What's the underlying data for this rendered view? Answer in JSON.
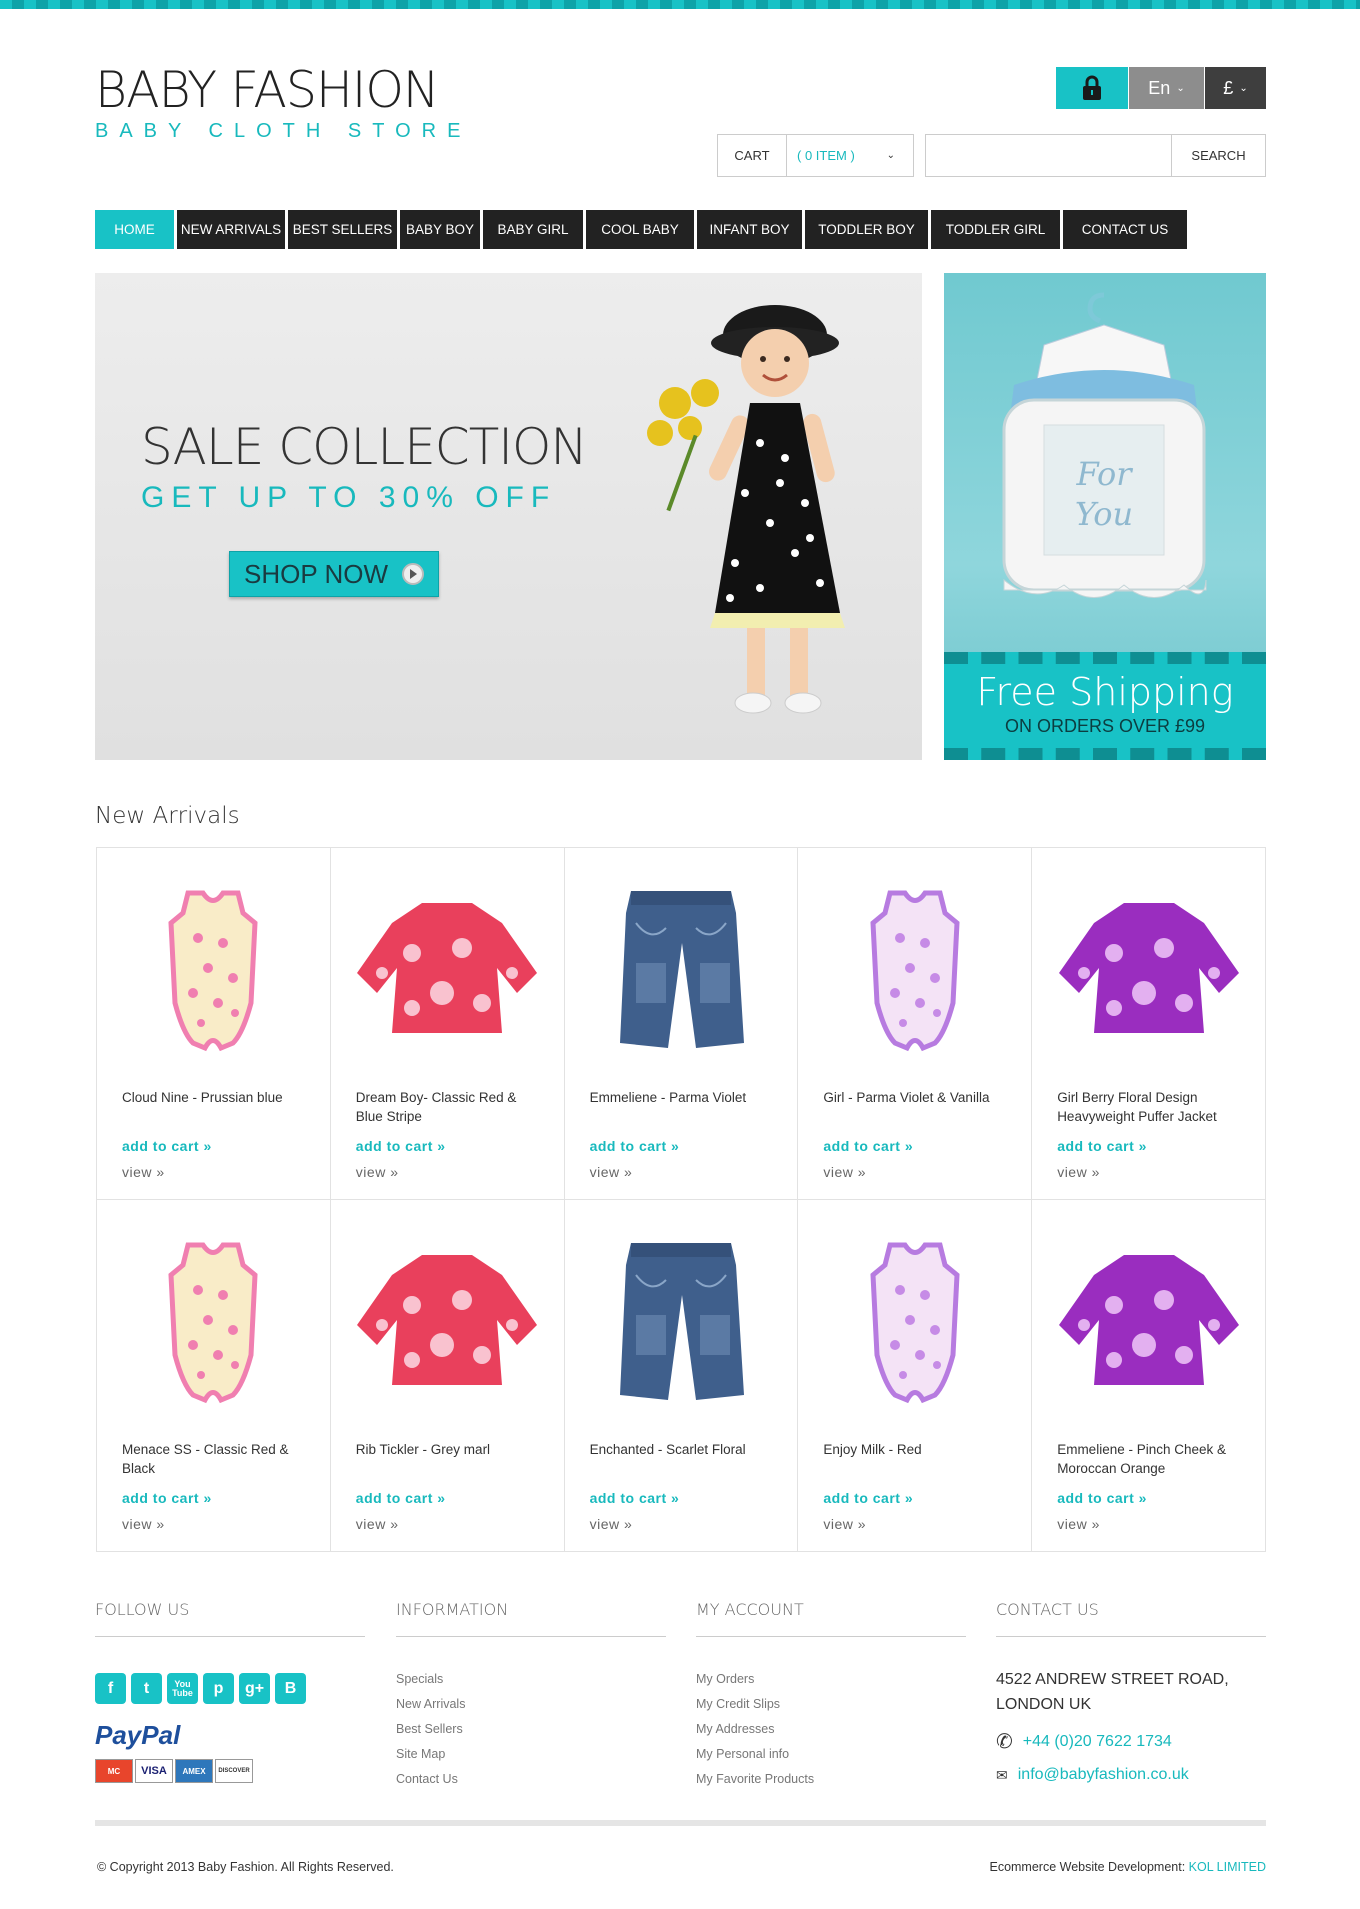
{
  "brand": {
    "title": "BABY FASHION",
    "subtitle": "BABY CLOTH STORE"
  },
  "utility": {
    "lang": "En",
    "currency": "£"
  },
  "cart": {
    "label": "CART",
    "value": "( 0 ITEM )"
  },
  "search": {
    "placeholder": "",
    "button": "SEARCH"
  },
  "nav": [
    "HOME",
    "NEW ARRIVALS",
    "BEST SELLERS",
    "BABY BOY",
    "BABY GIRL",
    "COOL BABY",
    "INFANT BOY",
    "TODDLER BOY",
    "TODDLER GIRL",
    "CONTACT US"
  ],
  "banner": {
    "title": "SALE COLLECTION",
    "subtitle": "GET UP TO 30% OFF",
    "cta": "SHOP NOW"
  },
  "side": {
    "frame_text": "For You",
    "ship_title": "Free Shipping",
    "ship_sub": "ON ORDERS OVER £99"
  },
  "section_title": "New Arrivals",
  "product_actions": {
    "add": "add to cart »",
    "view": "view »"
  },
  "products": [
    {
      "name": "Cloud Nine - Prussian blue",
      "kind": "onesie-pink"
    },
    {
      "name": "Dream Boy- Classic Red & Blue Stripe",
      "kind": "dress-red"
    },
    {
      "name": "Emmeliene - Parma Violet",
      "kind": "jeans"
    },
    {
      "name": "Girl - Parma Violet & Vanilla",
      "kind": "onesie-violet"
    },
    {
      "name": "Girl Berry Floral Design Heavyweight Puffer Jacket",
      "kind": "dress-purple"
    },
    {
      "name": "Menace SS - Classic Red & Black",
      "kind": "onesie-pink"
    },
    {
      "name": "Rib Tickler - Grey marl",
      "kind": "dress-red"
    },
    {
      "name": "Enchanted - Scarlet Floral",
      "kind": "jeans"
    },
    {
      "name": "Enjoy Milk - Red",
      "kind": "onesie-violet"
    },
    {
      "name": "Emmeliene - Pinch Cheek & Moroccan Orange",
      "kind": "dress-purple"
    }
  ],
  "footer": {
    "follow": {
      "title": "FOLLOW US",
      "social": [
        "f",
        "t",
        "You Tube",
        "p",
        "g+",
        "b"
      ],
      "paypal": "PayPal",
      "cards": [
        "MasterCard",
        "VISA",
        "AMEX",
        "DISCOVER"
      ]
    },
    "information": {
      "title": "INFORMATION",
      "links": [
        "Specials",
        "New Arrivals",
        "Best Sellers",
        "Site Map",
        "Contact Us"
      ]
    },
    "account": {
      "title": "MY ACCOUNT",
      "links": [
        "My Orders",
        "My Credit Slips",
        "My Addresses",
        "My Personal info",
        "My Favorite Products"
      ]
    },
    "contact": {
      "title": "CONTACT US",
      "address1": "4522 ANDREW STREET ROAD,",
      "address2": "LONDON UK",
      "phone": "+44 (0)20 7622 1734",
      "email": "info@babyfashion.co.uk"
    },
    "copyright": "© Copyright 2013 Baby Fashion. All Rights Reserved.",
    "dev_label": "Ecommerce Website Development:",
    "dev_name": "KOL LIMITED"
  }
}
